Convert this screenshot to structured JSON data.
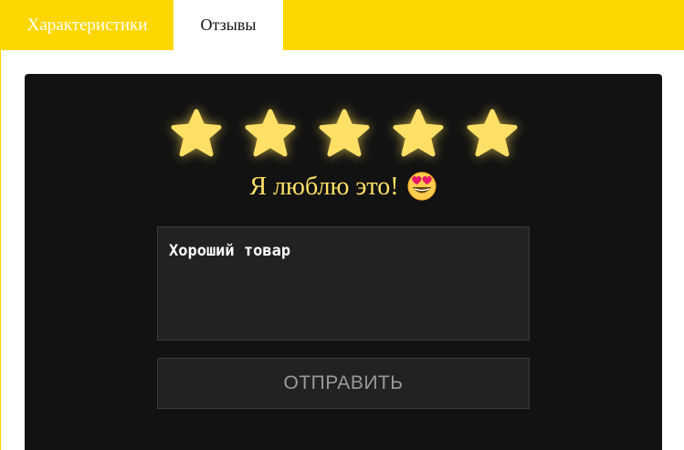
{
  "tabs": [
    {
      "label": "Характеристики",
      "active": false
    },
    {
      "label": "Отзывы",
      "active": true
    }
  ],
  "rating": {
    "value": 5,
    "max": 5,
    "text": "Я люблю это!",
    "emoji_icon": "star-struck-heart-eyes-emoji",
    "star_color": "#ffe066"
  },
  "review": {
    "value": "Хороший товар"
  },
  "submit": {
    "label": "ОТПРАВИТЬ"
  },
  "colors": {
    "accent": "#ffd700",
    "panel": "#121212",
    "field": "#222222"
  }
}
